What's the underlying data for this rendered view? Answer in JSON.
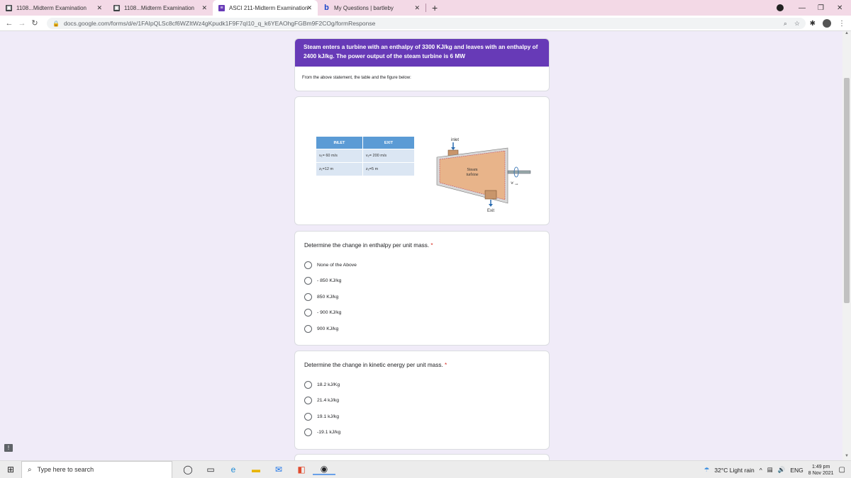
{
  "browser": {
    "tabs": [
      {
        "label": "1108...Midterm Examination",
        "icon": "image-icon"
      },
      {
        "label": "1108...Midterm Examination",
        "icon": "image-icon"
      },
      {
        "label": "ASCI 211-Midterm Examination",
        "icon": "forms-icon",
        "active": true
      },
      {
        "label": "My Questions | bartleby",
        "icon": "bartleby-icon"
      }
    ],
    "url": "docs.google.com/forms/d/e/1FAIpQLSc8cf6WZItWz4gKpudk1F9F7qI10_q_k6YEAOhgFGBm9F2COg/formResponse"
  },
  "form": {
    "header_text": "Steam enters a turbine with an enthalpy of 3300 KJ/kg and leaves with an enthalpy of 2400 kJ/kg. The power output of the steam turbine is 6 MW",
    "subtext": "From the above statement, the table and the figure below:",
    "figure": {
      "table_headers": [
        "INLET",
        "EXIT"
      ],
      "table_rows": [
        [
          "v₁= 60 m/s",
          "v₂= 200 m/s"
        ],
        [
          "z₁=12 m",
          "z₂=5 m"
        ]
      ],
      "inlet_label": "inlet",
      "exit_label": "Exit",
      "turbine_label_1": "Steam",
      "turbine_label_2": "turbine",
      "wout_label": "W",
      "wout_sub": "out"
    },
    "questions": [
      {
        "title": "Determine the change in enthalpy per unit mass.",
        "required": "*",
        "options": [
          "None of the Above",
          "- 850 KJ/kg",
          "850 KJ/kg",
          "- 900 KJ/kg",
          "900 KJ/kg"
        ]
      },
      {
        "title": "Determine the change in kinetic energy per unit mass.",
        "required": "*",
        "options": [
          "18.2 kJ/Kg",
          "21.4 kJ/kg",
          "19.1 kJ/kg",
          "-19.1 kJ/kg"
        ]
      }
    ]
  },
  "taskbar": {
    "search_placeholder": "Type here to search",
    "weather": "32°C  Light rain",
    "lang": "ENG",
    "time": "1:49 pm",
    "date": "8 Nov 2021"
  }
}
